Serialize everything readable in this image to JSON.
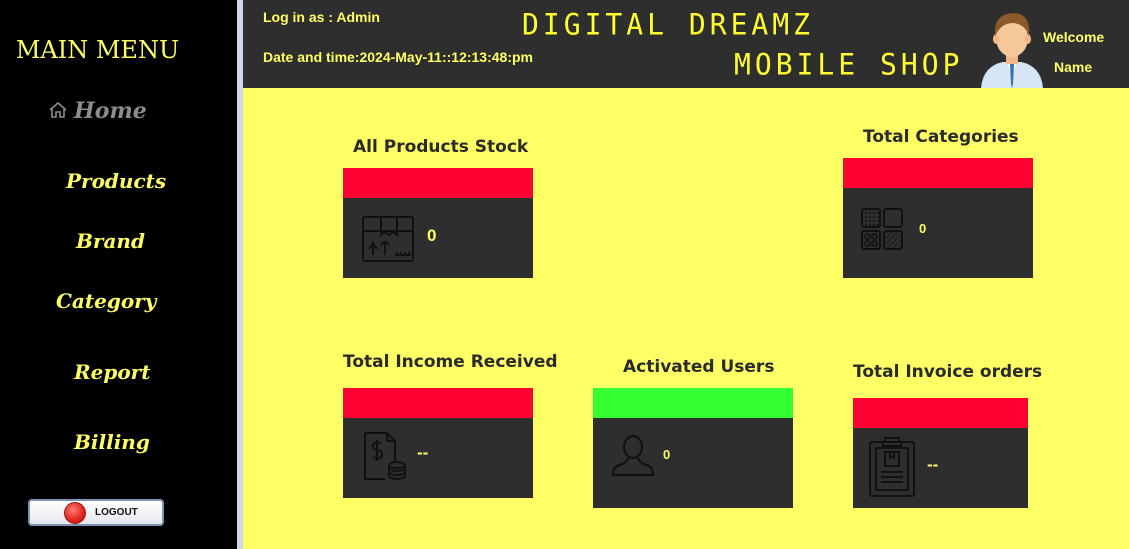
{
  "sidebar": {
    "title": "MAIN MENU",
    "items": [
      {
        "label": "Home"
      },
      {
        "label": "Products"
      },
      {
        "label": "Brand"
      },
      {
        "label": "Category"
      },
      {
        "label": "Report"
      },
      {
        "label": "Billing"
      }
    ],
    "logout_label": "LOGOUT"
  },
  "header": {
    "login": "Log in as : Admin",
    "datetime": "Date and time:2024-May-11::12:13:48:pm",
    "brand_line1": "DIGITAL DREAMZ",
    "brand_line2": "MOBILE SHOP",
    "welcome": "Welcome",
    "name": "Name"
  },
  "cards": {
    "products": {
      "title": "All Products Stock",
      "value": "0",
      "icon": "box-icon"
    },
    "categories": {
      "title": "Total Categories",
      "value": "0",
      "icon": "categories-icon"
    },
    "income": {
      "title": "Total Income Received",
      "value": "--",
      "icon": "invoice-money-icon"
    },
    "users": {
      "title": "Activated Users",
      "value": "0",
      "icon": "user-icon"
    },
    "orders": {
      "title": "Total Invoice orders",
      "value": "--",
      "icon": "clipboard-icon"
    }
  },
  "colors": {
    "accent_yellow": "#ffff66",
    "card_bar_red": "#ff0033",
    "card_bar_green": "#33ff33",
    "card_body": "#2e2e2e"
  }
}
